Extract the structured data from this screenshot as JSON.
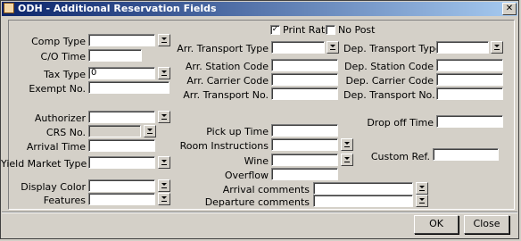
{
  "window": {
    "title": "ODH - Additional Reservation Fields",
    "close_glyph": "✕"
  },
  "top": {
    "print_rate": {
      "label": "Print Rate",
      "checked": true
    },
    "no_post": {
      "label": "No Post",
      "checked": false
    }
  },
  "left": {
    "comp_type": {
      "label": "Comp Type",
      "value": ""
    },
    "co_time": {
      "label": "C/O Time",
      "value": ""
    },
    "tax_type": {
      "label": "Tax Type",
      "value": "0"
    },
    "exempt_no": {
      "label": "Exempt No.",
      "value": ""
    },
    "authorizer": {
      "label": "Authorizer",
      "value": ""
    },
    "crs_no": {
      "label": "CRS  No.",
      "value": ""
    },
    "arrival_time": {
      "label": "Arrival Time",
      "value": ""
    },
    "yield_market_type": {
      "label": "Yield Market Type",
      "value": ""
    },
    "display_color": {
      "label": "Display Color",
      "value": ""
    },
    "features": {
      "label": "Features",
      "value": ""
    }
  },
  "middle": {
    "arr_transport_type": {
      "label": "Arr. Transport Type",
      "value": ""
    },
    "arr_station_code": {
      "label": "Arr. Station Code",
      "value": ""
    },
    "arr_carrier_code": {
      "label": "Arr. Carrier Code",
      "value": ""
    },
    "arr_transport_no": {
      "label": "Arr. Transport No.",
      "value": ""
    },
    "pick_up_time": {
      "label": "Pick up Time",
      "value": ""
    },
    "room_instructions": {
      "label": "Room Instructions",
      "value": ""
    },
    "wine": {
      "label": "Wine",
      "value": ""
    },
    "overflow": {
      "label": "Overflow",
      "value": ""
    },
    "arrival_comments": {
      "label": "Arrival comments",
      "value": ""
    },
    "departure_comments": {
      "label": "Departure comments",
      "value": ""
    }
  },
  "right": {
    "dep_transport_type": {
      "label": "Dep. Transport Type",
      "value": ""
    },
    "dep_station_code": {
      "label": "Dep. Station Code",
      "value": ""
    },
    "dep_carrier_code": {
      "label": "Dep. Carrier Code",
      "value": ""
    },
    "dep_transport_no": {
      "label": "Dep. Transport No.",
      "value": ""
    },
    "drop_off_time": {
      "label": "Drop off Time",
      "value": ""
    },
    "custom_ref": {
      "label": "Custom Ref.",
      "value": ""
    }
  },
  "buttons": {
    "ok": "OK",
    "close": "Close"
  },
  "icons": {
    "dropdown": "dropdown-arrow-icon",
    "title": "app-window-icon"
  }
}
